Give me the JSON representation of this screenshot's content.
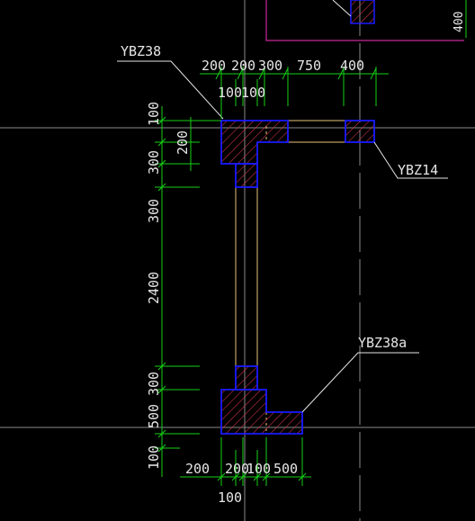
{
  "drawing": {
    "colors": {
      "background": "#000000",
      "axis": "#8a8a8a",
      "dimension": "#16d016",
      "dimension_text": "#e6e6e6",
      "leader": "#e6e6e6",
      "column_outline": "#1a1aff",
      "column_hatch": "#c8324b",
      "wall": "#e6c27a",
      "magenta": "#c8289b"
    },
    "labels": {
      "ybz38": "YBZ38",
      "ybz14": "YBZ14",
      "ybz38a": "YBZ38a"
    },
    "top_dims": {
      "row1": [
        "200",
        "200",
        "300",
        "750",
        "400"
      ],
      "row2": [
        "100",
        "100"
      ]
    },
    "left_dims": [
      "100",
      "300",
      "300",
      "2400",
      "300",
      "500",
      "100"
    ],
    "inner_dim": "200",
    "bottom_dims": {
      "row1": [
        "200",
        "200",
        "100",
        "500"
      ],
      "row2": [
        "100"
      ]
    },
    "corner_dim": "400"
  }
}
